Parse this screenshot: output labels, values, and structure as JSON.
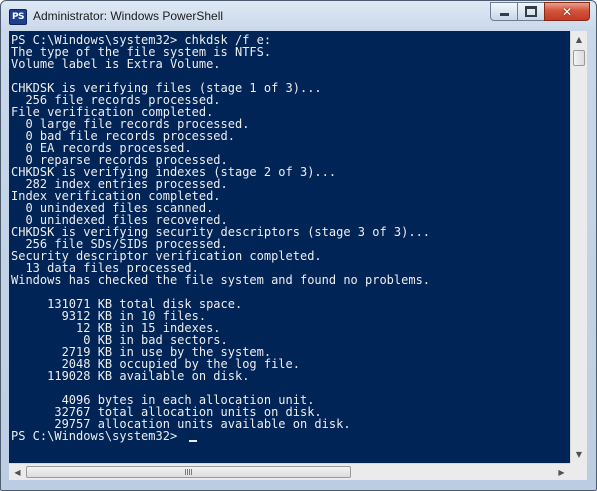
{
  "window": {
    "title": "Administrator: Windows PowerShell",
    "icon_label": "PS",
    "icon": "powershell-icon"
  },
  "caption_buttons": {
    "minimize_icon": "minimize-icon",
    "maximize_icon": "maximize-icon",
    "close_icon": "close-icon",
    "close_glyph": "✕"
  },
  "console": {
    "lines": [
      "PS C:\\Windows\\system32> chkdsk /f e:",
      "The type of the file system is NTFS.",
      "Volume label is Extra Volume.",
      "",
      "CHKDSK is verifying files (stage 1 of 3)...",
      "  256 file records processed.",
      "File verification completed.",
      "  0 large file records processed.",
      "  0 bad file records processed.",
      "  0 EA records processed.",
      "  0 reparse records processed.",
      "CHKDSK is verifying indexes (stage 2 of 3)...",
      "  282 index entries processed.",
      "Index verification completed.",
      "  0 unindexed files scanned.",
      "  0 unindexed files recovered.",
      "CHKDSK is verifying security descriptors (stage 3 of 3)...",
      "  256 file SDs/SIDs processed.",
      "Security descriptor verification completed.",
      "  13 data files processed.",
      "Windows has checked the file system and found no problems.",
      "",
      "     131071 KB total disk space.",
      "       9312 KB in 10 files.",
      "         12 KB in 15 indexes.",
      "          0 KB in bad sectors.",
      "       2719 KB in use by the system.",
      "       2048 KB occupied by the log file.",
      "     119028 KB available on disk.",
      "",
      "       4096 bytes in each allocation unit.",
      "      32767 total allocation units on disk.",
      "      29757 allocation units available on disk.",
      "PS C:\\Windows\\system32> "
    ]
  },
  "scrollbars": {
    "up_arrow": "▲",
    "down_arrow": "▼",
    "left_arrow": "◀",
    "right_arrow": "▶"
  }
}
